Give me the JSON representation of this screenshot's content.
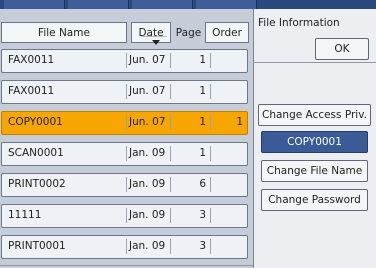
{
  "columns": {
    "file_name": "File Name",
    "date": "Date",
    "page": "Page",
    "order": "Order"
  },
  "rows": [
    {
      "file": "FAX0011",
      "date": "Jun. 07",
      "page": "1",
      "order": ""
    },
    {
      "file": "FAX0011",
      "date": "Jun. 07",
      "page": "1",
      "order": ""
    },
    {
      "file": "COPY0001",
      "date": "Jun. 07",
      "page": "1",
      "order": "1"
    },
    {
      "file": "SCAN0001",
      "date": "Jan. 09",
      "page": "1",
      "order": ""
    },
    {
      "file": "PRINT0002",
      "date": "Jan. 09",
      "page": "6",
      "order": ""
    },
    {
      "file": "11111",
      "date": "Jan. 09",
      "page": "3",
      "order": ""
    },
    {
      "file": "PRINT0001",
      "date": "Jan. 09",
      "page": "3",
      "order": ""
    }
  ],
  "selected_row": 2,
  "info_panel": {
    "title": "File Information",
    "ok": "OK",
    "change_access": "Change Access Priv.",
    "selected_file": "COPY0001",
    "change_file_name": "Change File Name",
    "change_password": "Change Password"
  },
  "colors": {
    "selected_row": "#f7a600",
    "accent": "#3a5a98",
    "topbar": "#2a477e"
  }
}
